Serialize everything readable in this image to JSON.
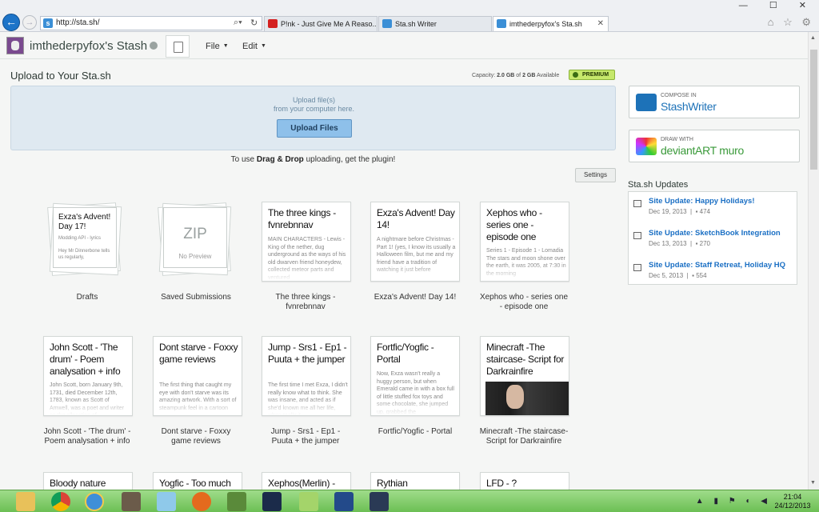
{
  "browser": {
    "address_url": "http://sta.sh/",
    "tabs": [
      {
        "label": "P!nk - Just Give Me A Reaso...",
        "color": "#d42020"
      },
      {
        "label": "Sta.sh Writer",
        "color": "#3b8fd6"
      },
      {
        "label": "imthederpyfox's Sta.sh",
        "color": "#3b8fd6",
        "active": true
      }
    ],
    "window_controls": "— ☐ ✕",
    "right_icons": "⌂ ☆ ⚙"
  },
  "header": {
    "stash_title": "imthederpyfox's Stash",
    "menus": [
      "File",
      "Edit"
    ]
  },
  "upload": {
    "title": "Upload to Your Sta.sh",
    "capacity_label": "Capacity:",
    "capacity_value": "2.0 GB",
    "capacity_of": "of",
    "capacity_total": "2 GB",
    "capacity_available": "Available",
    "premium_label": "PREMIUM",
    "line1": "Upload file(s)",
    "line2": "from your computer here.",
    "button": "Upload Files",
    "plugin_prefix": "To use ",
    "plugin_bold": "Drag & Drop",
    "plugin_suffix": " uploading, get the plugin!",
    "settings": "Settings"
  },
  "grid": {
    "row1": {
      "drafts": {
        "title": "Exza's Advent! Day 17!",
        "body": "Modding API - lyrics\n\nHey Mr Dinnerbone tells us regularly,",
        "caption": "Drafts"
      },
      "saved": {
        "zip": "ZIP",
        "nopreview": "No Preview",
        "caption": "Saved Submissions"
      },
      "items": [
        {
          "title": "The three kings - fvnrebnnav",
          "body": "MAIN CHARACTERS - Lewis - King of the nether, dug underground as the ways of his old dwarven friend honeydew, collected meteor parts and ventured",
          "caption": "The three kings - fvnrebnnav"
        },
        {
          "title": "Exza's Advent! Day 14!",
          "body": "A nightmare before Christmas - Part 1! (yes, I know its usually a Halloween film, but me and my friend have a tradition of watching it just before",
          "caption": "Exza's Advent! Day 14!"
        },
        {
          "title": "Xephos who - series one - episode one",
          "body": "Series 1 - Episode 1 - Lomadia\nThe stars and moon shone over the earth, it was 2005, at 7:30 in the morning",
          "caption": "Xephos who - series one - episode one"
        }
      ]
    },
    "row2": [
      {
        "title": "John Scott - 'The drum' - Poem analysation + info",
        "body": "John Scott, born January 9th, 1731, died December 12th, 1783, known as Scott of Amwell, was a poet and writer on the allocation of",
        "caption": "John Scott - 'The drum' - Poem analysation + info"
      },
      {
        "title": "Dont starve - Foxxy game reviews",
        "body": "The first thing that caught my eye with don't starve was its amazing artwork. With a sort of steampunk feel in a cartoon",
        "caption": "Dont starve - Foxxy game reviews"
      },
      {
        "title": "Jump - Srs1 - Ep1 - Puuta + the jumper",
        "body": "The first time I met Exza, I didn't really know what to think. She was insane, and acted as if she'd known me all her life, when really it",
        "caption": "Jump - Srs1 - Ep1 - Puuta + the jumper"
      },
      {
        "title": "Fortfic/Yogfic - Portal",
        "body": "Now, Exza wasn't really a huggy person, but when Emerald came in with a box full of little stuffed fox toys and some chocolate, she jumped up, grabbed the",
        "caption": "Fortfic/Yogfic - Portal"
      },
      {
        "title": "Minecraft -The staircase- Script for Darkrainfire",
        "body": "",
        "caption": "Minecraft -The staircase- Script for Darkrainfire"
      }
    ],
    "row3": [
      {
        "title": "Bloody nature"
      },
      {
        "title": "Yogfic - Too much"
      },
      {
        "title": "Xephos(Merlin) -"
      },
      {
        "title": "Rythian"
      },
      {
        "title": "LFD - ?"
      }
    ]
  },
  "sidebar": {
    "compose_small": "COMPOSE IN",
    "compose_big": "StashWriter",
    "draw_small": "DRAW WITH",
    "draw_big": "deviantART muro",
    "updates_title": "Sta.sh Updates",
    "updates": [
      {
        "title": "Site Update: Happy Holidays!",
        "date": "Dec 19, 2013",
        "comments": "474"
      },
      {
        "title": "Site Update: SketchBook Integration",
        "date": "Dec 13, 2013",
        "comments": "270"
      },
      {
        "title": "Site Update: Staff Retreat, Holiday HQ",
        "date": "Dec 5, 2013",
        "comments": "554"
      }
    ]
  },
  "taskbar": {
    "apps": [
      "file-explorer-icon",
      "chrome-icon",
      "internet-explorer-icon",
      "gimp-icon",
      "paint-icon",
      "firefox-icon",
      "minecraft-icon",
      "game-icon",
      "fb-icon",
      "app-icon",
      "steam-icon"
    ],
    "tray": "▲ ▮ ⚑ ◐ ◀",
    "time": "21:04",
    "date": "24/12/2013"
  }
}
